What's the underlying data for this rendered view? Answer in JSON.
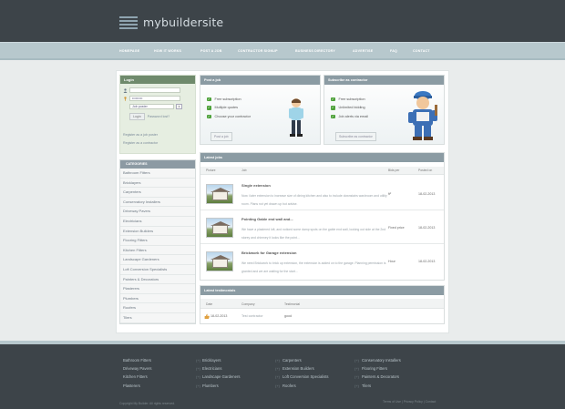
{
  "brand": {
    "name": "mybuildersite"
  },
  "nav": [
    "HOMEPAGE",
    "HOW IT WORKS",
    "POST A JOB",
    "CONTRACTOR SIGNUP",
    "BUSINESS DIRECTORY",
    "ADVERTISE",
    "FAQ",
    "CONTACT"
  ],
  "login": {
    "title": "Login",
    "password_value": "•••••••••",
    "role_value": "Job poster",
    "button": "Login",
    "forgot": "Password lost?",
    "links": [
      "Register as a job poster",
      "Register as a contractor"
    ]
  },
  "categories": {
    "title": "CATEGORIES",
    "items": [
      "Bathroom Fitters",
      "Bricklayers",
      "Carpenters",
      "Conservatory Installers",
      "Driveway Pavers",
      "Electricians",
      "Extension Builders",
      "Flooring Fitters",
      "Kitchen Fitters",
      "Landscape Gardeners",
      "Loft Conversion Specialists",
      "Painters & Decorators",
      "Plasterers",
      "Plumbers",
      "Roofers",
      "Tilers"
    ]
  },
  "post_job": {
    "title": "Post a job",
    "features": [
      "Free subscription",
      "Multiple quotes",
      "Choose your contractor"
    ],
    "button": "Post a job"
  },
  "subscribe": {
    "title": "Subscribe as contractor",
    "features": [
      "Free subscription",
      "Unlimited bidding",
      "Job alerts via email"
    ],
    "button": "Subscribe as contractor"
  },
  "latest_jobs": {
    "title": "Latest jobs",
    "columns": [
      "Picture",
      "Job",
      "Bids per",
      "Posted on"
    ],
    "rows": [
      {
        "title": "Single extension",
        "desc": "Now i later extension to increase size of dining kitchen and also to include downstairs washroom and utility room. Plans not yet drawn up but advise.",
        "bid": "ft²",
        "posted": "18-02-2013"
      },
      {
        "title": "Pointing Gable end wall and...",
        "desc": "We have a plastered loft, and noticed some damp spots on the gable end wall, looking out side at the 2nd storey and chimney it looks like the point...",
        "bid": "Fixed price",
        "posted": "18-02-2013"
      },
      {
        "title": "Brickwork for Garage extension",
        "desc": "We need Brickwork to brick up extension, the extension is added on to the garage. Planning permission is granted and we are waiting for the start...",
        "bid": "Hour",
        "posted": "18-02-2013"
      }
    ]
  },
  "testimonials": {
    "title": "Latest testimonials",
    "columns": [
      "Date",
      "Company",
      "Testimonial"
    ],
    "rows": [
      {
        "date": "18-02-2013",
        "company": "Test contractor",
        "text": "good"
      }
    ]
  },
  "footer": {
    "col1": [
      "Bathroom Fitters",
      "Driveway Pavers",
      "Kitchen Fitters",
      "Plasterers"
    ],
    "col2": [
      "Bricklayers",
      "Electricians",
      "Landscape Gardeners",
      "Plumbers"
    ],
    "col3": [
      "Carpenters",
      "Extension Builders",
      "Loft Conversion Specialists",
      "Roofers"
    ],
    "col4": [
      "Conservatory Installers",
      "Flooring Fitters",
      "Painters & Decorators",
      "Tilers"
    ],
    "separator": "(+)",
    "copyright": "Copyright My Builder. All rights reserved.",
    "links": "Terms of Use | Privacy Policy | Contact"
  },
  "colors": {
    "header": "#3d4449",
    "nav_band": "#b7c8cd",
    "check": "#4fa23b",
    "box_title": "#8b9ba3",
    "login_title": "#6f8a6c"
  }
}
